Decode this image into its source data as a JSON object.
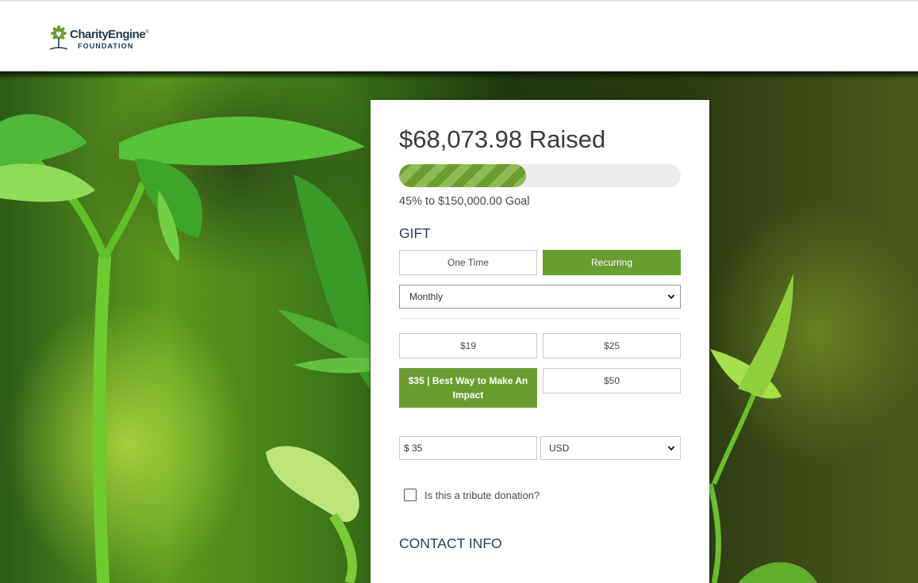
{
  "brand": {
    "name": "CharityEngine",
    "trademark": "®",
    "sub": "FOUNDATION",
    "colors": {
      "primary": "#233a4e",
      "accent": "#6a9d30"
    }
  },
  "campaign": {
    "raised_text": "$68,073.98 Raised",
    "progress_fraction": 0.45,
    "goal_text": "45% to $150,000.00 Goal"
  },
  "gift": {
    "title": "GIFT",
    "frequency_options": [
      {
        "label": "One Time",
        "active": false
      },
      {
        "label": "Recurring",
        "active": true
      }
    ],
    "recurrence_select": {
      "value": "Monthly",
      "icon": "chevron-down-icon"
    },
    "amounts": [
      {
        "label": "$19",
        "active": false
      },
      {
        "label": "$25",
        "active": false
      },
      {
        "label": "$35 | Best Way to Make An Impact",
        "active": true
      },
      {
        "label": "$50",
        "active": false
      }
    ],
    "amount_input": {
      "value": "$ 35"
    },
    "currency_select": {
      "value": "USD",
      "icon": "chevron-down-icon"
    },
    "tribute": {
      "label": "Is this a tribute donation?",
      "checked": false
    }
  },
  "contact": {
    "title": "CONTACT INFO"
  }
}
